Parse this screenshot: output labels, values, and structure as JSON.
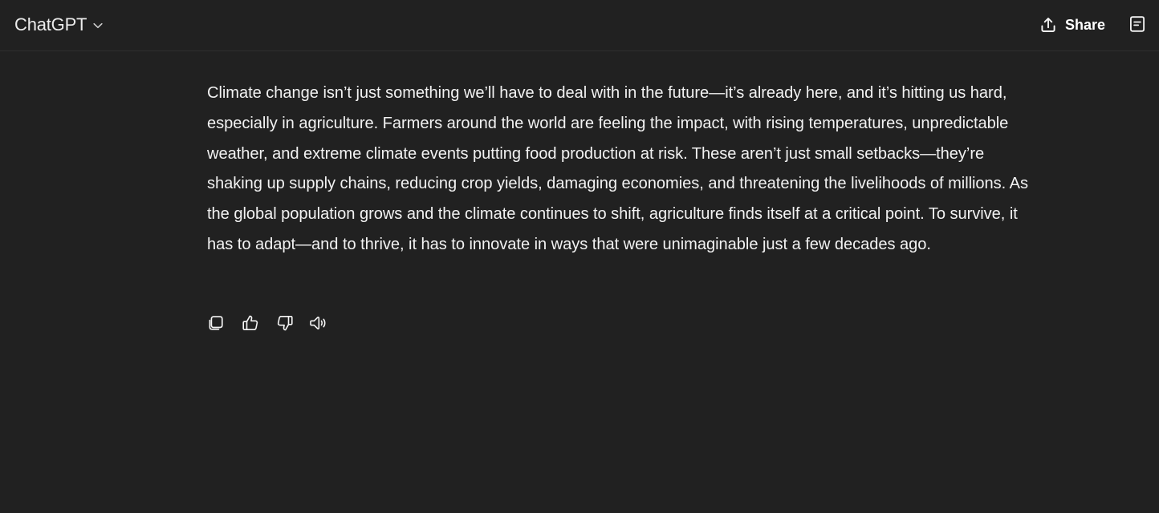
{
  "header": {
    "title": "ChatGPT",
    "model_menu_icon": "chevron-down-icon",
    "share_label": "Share",
    "share_icon": "upload-icon",
    "notes_icon": "document-icon"
  },
  "message": {
    "text": "Climate change isn’t just something we’ll have to deal with in the future—it’s already here, and it’s hitting us hard, especially in agriculture. Farmers around the world are feeling the impact, with rising temperatures, unpredictable weather, and extreme climate events putting food production at risk. These aren’t just small setbacks—they’re shaking up supply chains, reducing crop yields, damaging economies, and threatening the livelihoods of millions. As the global population grows and the climate continues to shift, agriculture finds itself at a critical point. To survive, it has to adapt—and to thrive, it has to innovate in ways that were unimaginable just a few decades ago."
  },
  "actions": {
    "icons": [
      "copy-icon",
      "thumbs-up-icon",
      "thumbs-down-icon",
      "speaker-icon"
    ]
  },
  "colors": {
    "background": "#212121",
    "text": "#ececec",
    "icon": "#f5f5f5",
    "divider": "#2f2f2f"
  }
}
